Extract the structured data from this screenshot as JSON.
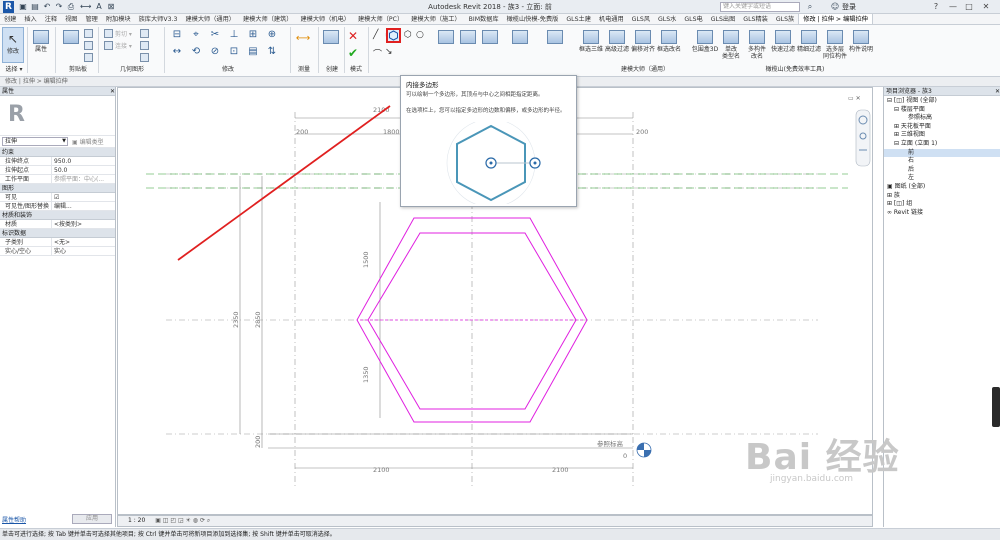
{
  "app": {
    "logo": "R",
    "title": "Autodesk Revit 2018 -    族3 - 立面: 前",
    "search_placeholder": "键入关键字或短语",
    "user": "登录"
  },
  "quick_access": [
    "open-icon",
    "save-icon",
    "undo-icon",
    "redo-icon",
    "print-icon",
    "measure-icon",
    "text-icon",
    "close-icon"
  ],
  "tabs": [
    "创建",
    "插入",
    "注释",
    "视图",
    "管理",
    "附加模块",
    "族库大师V3.3",
    "建模大师（通用）",
    "建模大师（建筑）",
    "建模大师（机电）",
    "建模大师（PC）",
    "建模大师（施工）",
    "BIM数据库",
    "橄榄山快模-免费版",
    "GLS土建",
    "机电通用",
    "GLS风",
    "GLS水",
    "GLS电",
    "GLS出图",
    "GLS精装",
    "GLS族",
    "修改 | 拉伸 > 编辑拉伸"
  ],
  "ribbon": {
    "modify_label": "修改",
    "select_label": "选择",
    "select_dropdown": "选择 ▾",
    "properties_label": "属性",
    "clipboard_label": "剪贴板",
    "geometry_label": "几何图形",
    "modify_group_label": "修改",
    "measure_label": "测量",
    "create_label": "创建",
    "mode_label": "模式",
    "draw_label": "绘制",
    "right_buttons": [
      {
        "label": "框选三维",
        "group": "建模大师（通用）"
      },
      {
        "label": "高级过滤",
        "group": ""
      },
      {
        "label": "偏移对齐",
        "group": ""
      },
      {
        "label": "框选改名",
        "group": ""
      },
      {
        "label": "包围盒3D",
        "group": ""
      },
      {
        "label": "单改\n类型名",
        "group": ""
      },
      {
        "label": "多构件\n改名",
        "group": ""
      },
      {
        "label": "快速过滤",
        "group": ""
      },
      {
        "label": "精细过滤",
        "group": ""
      },
      {
        "label": "选多层\n同位构件",
        "group": ""
      },
      {
        "label": "构件说明",
        "group": ""
      }
    ],
    "group_general": "建模大师（通用）",
    "group_olive": "橄榄山(免费效率工具)"
  },
  "options_bar": "修改 | 拉伸  >  编辑拉伸",
  "properties": {
    "title": "属性",
    "family_type": "拉伸",
    "edit_type": "编辑类型",
    "sections": [
      {
        "name": "约束",
        "rows": [
          {
            "k": "拉伸终点",
            "v": "950.0"
          },
          {
            "k": "拉伸起点",
            "v": "50.0"
          },
          {
            "k": "工作平面",
            "v": "参照平面：中心(..."
          }
        ]
      },
      {
        "name": "图形",
        "rows": [
          {
            "k": "可见",
            "v": "☑"
          },
          {
            "k": "可见性/图形替换",
            "v": "编辑..."
          }
        ]
      },
      {
        "name": "材质和装饰",
        "rows": [
          {
            "k": "材质",
            "v": "<按类别>"
          }
        ]
      },
      {
        "name": "标识数据",
        "rows": [
          {
            "k": "子类别",
            "v": "<无>"
          },
          {
            "k": "实心/空心",
            "v": "实心"
          }
        ]
      }
    ],
    "help": "属性帮助",
    "apply": "应用"
  },
  "tooltip": {
    "title": "内接多边形",
    "line1": "可以绘制一个多边形，其顶点与中心之间相距指定距离。",
    "line2": "在选项栏上，您可以指定多边形的边数和偏移，或多边形的半径。"
  },
  "drawing": {
    "dims": [
      "2100",
      "1800",
      "200",
      "200",
      "2100",
      "2100",
      "1500",
      "1350",
      "2350",
      "2850",
      "200"
    ],
    "ref_label": "参照标高",
    "ref_value": "0"
  },
  "view_bar": {
    "scale": "1 : 20"
  },
  "browser": {
    "title": "项目浏览器 - 族3",
    "items": [
      {
        "t": "⊟ [◫] 视图 (全部)",
        "i": 0
      },
      {
        "t": "⊟  楼层平面",
        "i": 1
      },
      {
        "t": "参照标高",
        "i": 3
      },
      {
        "t": "⊞  天花板平面",
        "i": 1
      },
      {
        "t": "⊞  三维视图",
        "i": 1
      },
      {
        "t": "⊟  立面 (立面 1)",
        "i": 1
      },
      {
        "t": "前",
        "i": 3
      },
      {
        "t": "右",
        "i": 3
      },
      {
        "t": "后",
        "i": 3
      },
      {
        "t": "左",
        "i": 3
      },
      {
        "t": "▣ 图纸 (全部)",
        "i": 0
      },
      {
        "t": "⊞ 族",
        "i": 0
      },
      {
        "t": "⊞ [◫] 组",
        "i": 0
      },
      {
        "t": "∞ Revit 链接",
        "i": 0
      }
    ]
  },
  "status": "单击可进行选择; 按 Tab 键并单击可选择其他项目; 按 Ctrl 键并单击可将新项目添加到选择集; 按 Shift 键并单击可取消选择。",
  "watermark": {
    "brand": "Bai 经验",
    "url": "jingyan.baidu.com"
  },
  "colors": {
    "accent": "#1a56a8",
    "sketch": "#e020e0",
    "annotation": "#e02020",
    "tooltip_hex": "#4a96b8"
  }
}
